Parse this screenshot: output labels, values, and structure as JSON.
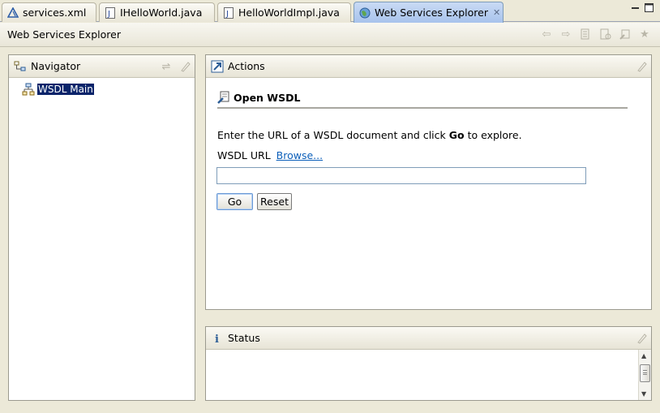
{
  "tabs": [
    {
      "label": "services.xml",
      "icon": "xml-file-icon"
    },
    {
      "label": "IHelloWorld.java",
      "icon": "java-file-icon"
    },
    {
      "label": "HelloWorldImpl.java",
      "icon": "java-file-icon"
    },
    {
      "label": "Web Services Explorer",
      "icon": "globe-icon",
      "active": true
    }
  ],
  "explorer": {
    "title": "Web Services Explorer"
  },
  "navigator": {
    "title": "Navigator",
    "tree": [
      {
        "label": "WSDL Main",
        "selected": true
      }
    ]
  },
  "actions": {
    "title": "Actions",
    "section_title": "Open WSDL",
    "instruction_prefix": "Enter the URL of a WSDL document and click",
    "instruction_bold": "Go",
    "instruction_suffix": "to explore.",
    "url_label": "WSDL URL",
    "browse_link": "Browse...",
    "url_value": "",
    "go_label": "Go",
    "reset_label": "Reset"
  },
  "status": {
    "title": "Status"
  },
  "colors": {
    "accent": "#0a246a",
    "link": "#0c5fba",
    "chrome": "#ece9d8"
  }
}
